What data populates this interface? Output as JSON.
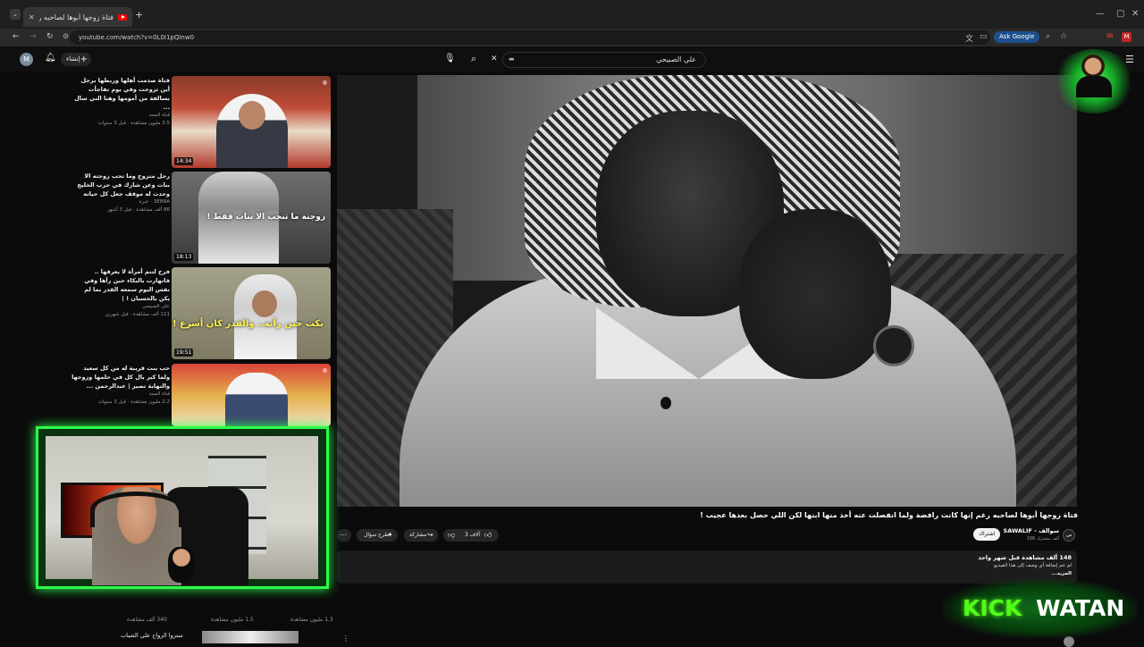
{
  "browser": {
    "tab_title": "فتاة زوجها أبوها لصاحبه رغم",
    "url": "youtube.com/watch?v=0L0I1pQInw0",
    "ask_google": "Ask Google"
  },
  "youtube": {
    "avatar_letter": "M",
    "create_label": "إنشاء",
    "search_query": "علي الصبيحي"
  },
  "sidebar": {
    "items": [
      {
        "title": "فتاة صدمت أهلها وربطها برجل أين تزوجت وفي يوم تفاجأت بسالفة من أمومها وهنا التي سال ...",
        "channel": "قناة المجد",
        "meta": "3.5 مليون مشاهدة · قبل 3 سنوات",
        "duration": "14:34",
        "overlay_text": ""
      },
      {
        "title": "رجل متزوج وما تحب زوجته الا بنات وعن شارك في حرب الخليج وحدث له موقف جعل كل حياته",
        "channel": "3EBRA · عبرة",
        "meta": "86 ألف مشاهدة · قبل 3 أشهر",
        "duration": "18:13",
        "overlay_text": "زوجتة ما تنجب الا بنات فقط !"
      },
      {
        "title": "فرح لتتم أمرأة لا يعرفها .. فانهارت بالبكاء حين رآها وفي نفس اليوم سمعه القدر بما لم يكن بالحسبان ! |",
        "channel": "علي الصبيحي",
        "meta": "111 ألف مشاهدة · قبل شهرين",
        "duration": "19:51",
        "overlay_text": "بكت حين رآته.. والقدر كان أسرع !"
      },
      {
        "title": "حب بنت قريبة له من كل سعيد ولما كبر بال كل في حلمها وزوجها والنهاية تصير | عبدالرحمن ...",
        "channel": "قناة المجد",
        "meta": "2.2 مليون مشاهدة · قبل 3 سنوات",
        "duration": "",
        "overlay_text": ""
      }
    ],
    "bottom_item_title": "ستروا الزواج على الشباب"
  },
  "bottom_meta": {
    "col1": "340 ألف مشاهدة",
    "col2": "1.5 مليون مشاهدة",
    "col3": "1.3 مليون مشاهدة"
  },
  "video": {
    "title": "فتاة زوجها أبوها لصاحبه رغم إنها كانت رافضة ولما انفصلت عنه أخذ منها ابنها لكن اللي حصل بعدها عجيب !",
    "channel_name": "SAWALIF - سوالف",
    "subscribers": "186 ألف مشترك",
    "join_label": "اشتراك",
    "likes": "3 آلاف",
    "share_label": "مشاركة",
    "ask_label": "طرح سؤال",
    "views_date": "148 ألف مشاهدة قبل شهر واحد",
    "desc_line1": "لم تتم إضافة أي وصف إلى هذا الفيديو.",
    "desc_line2": "...المزيد"
  },
  "overlay": {
    "kick_word": "KICK",
    "watan_word": "WATAN"
  },
  "colors": {
    "kick_green": "#53fc18",
    "youtube_red": "#ff0000",
    "neon_border": "#2cff4a"
  }
}
